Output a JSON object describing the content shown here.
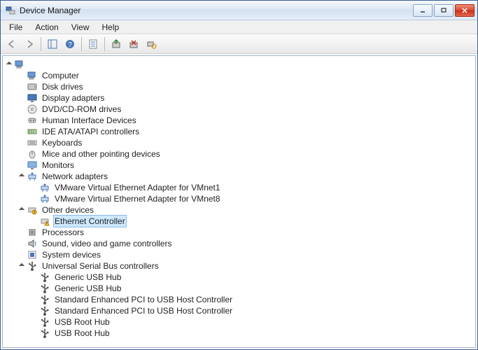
{
  "window": {
    "title": "Device Manager"
  },
  "menu": {
    "items": [
      "File",
      "Action",
      "View",
      "Help"
    ]
  },
  "toolbar": {
    "buttons": [
      "back",
      "forward",
      "sep",
      "show-hide-console-tree",
      "help",
      "sep",
      "properties",
      "sep",
      "update-driver",
      "uninstall",
      "scan-hardware"
    ]
  },
  "tree": {
    "root": {
      "label": "",
      "expanded": true,
      "icon": "computer",
      "children": [
        {
          "label": "Computer",
          "expanded": false,
          "icon": "computer"
        },
        {
          "label": "Disk drives",
          "expanded": false,
          "icon": "disk"
        },
        {
          "label": "Display adapters",
          "expanded": false,
          "icon": "display"
        },
        {
          "label": "DVD/CD-ROM drives",
          "expanded": false,
          "icon": "dvd"
        },
        {
          "label": "Human Interface Devices",
          "expanded": false,
          "icon": "hid"
        },
        {
          "label": "IDE ATA/ATAPI controllers",
          "expanded": false,
          "icon": "ide"
        },
        {
          "label": "Keyboards",
          "expanded": false,
          "icon": "keyboard"
        },
        {
          "label": "Mice and other pointing devices",
          "expanded": false,
          "icon": "mouse"
        },
        {
          "label": "Monitors",
          "expanded": false,
          "icon": "monitor"
        },
        {
          "label": "Network adapters",
          "expanded": true,
          "icon": "network",
          "children": [
            {
              "label": "VMware Virtual Ethernet Adapter for VMnet1",
              "icon": "network"
            },
            {
              "label": "VMware Virtual Ethernet Adapter for VMnet8",
              "icon": "network"
            }
          ]
        },
        {
          "label": "Other devices",
          "expanded": true,
          "icon": "other",
          "children": [
            {
              "label": "Ethernet Controller",
              "icon": "other-warn",
              "selected": true
            }
          ]
        },
        {
          "label": "Processors",
          "expanded": false,
          "icon": "cpu"
        },
        {
          "label": "Sound, video and game controllers",
          "expanded": false,
          "icon": "sound"
        },
        {
          "label": "System devices",
          "expanded": false,
          "icon": "system"
        },
        {
          "label": "Universal Serial Bus controllers",
          "expanded": true,
          "icon": "usb",
          "children": [
            {
              "label": "Generic USB Hub",
              "icon": "usb"
            },
            {
              "label": "Generic USB Hub",
              "icon": "usb"
            },
            {
              "label": "Standard Enhanced PCI to USB Host Controller",
              "icon": "usb"
            },
            {
              "label": "Standard Enhanced PCI to USB Host Controller",
              "icon": "usb"
            },
            {
              "label": "USB Root Hub",
              "icon": "usb"
            },
            {
              "label": "USB Root Hub",
              "icon": "usb"
            }
          ]
        }
      ]
    }
  }
}
